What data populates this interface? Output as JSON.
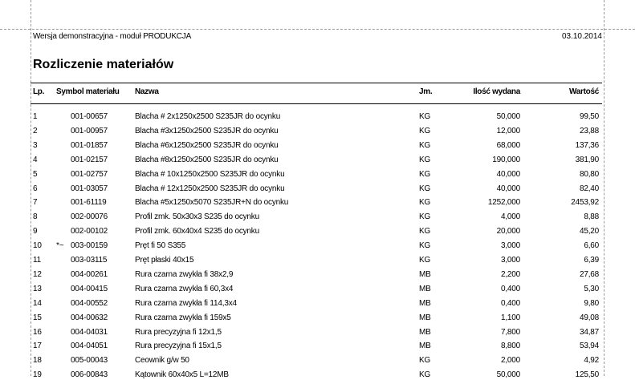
{
  "report": {
    "header_left": "Wersja demonstracyjna - moduł PRODUKCJA",
    "header_date": "03.10.2014",
    "title": "Rozliczenie materiałów"
  },
  "table": {
    "columns": {
      "lp": "Lp.",
      "symbol": "Symbol materiału",
      "name": "Nazwa",
      "unit": "Jm.",
      "qty": "Ilość wydana",
      "value": "Wartość"
    },
    "rows": [
      {
        "lp": "1",
        "marker": "",
        "symbol": "001-00657",
        "name": "Blacha # 2x1250x2500 S235JR do ocynku",
        "unit": "KG",
        "qty": "50,000",
        "value": "99,50"
      },
      {
        "lp": "2",
        "marker": "",
        "symbol": "001-00957",
        "name": "Blacha #3x1250x2500 S235JR do ocynku",
        "unit": "KG",
        "qty": "12,000",
        "value": "23,88"
      },
      {
        "lp": "3",
        "marker": "",
        "symbol": "001-01857",
        "name": "Blacha #6x1250x2500 S235JR do ocynku",
        "unit": "KG",
        "qty": "68,000",
        "value": "137,36"
      },
      {
        "lp": "4",
        "marker": "",
        "symbol": "001-02157",
        "name": "Blacha #8x1250x2500 S235JR do ocynku",
        "unit": "KG",
        "qty": "190,000",
        "value": "381,90"
      },
      {
        "lp": "5",
        "marker": "",
        "symbol": "001-02757",
        "name": "Blacha # 10x1250x2500 S235JR do ocynku",
        "unit": "KG",
        "qty": "40,000",
        "value": "80,80"
      },
      {
        "lp": "6",
        "marker": "",
        "symbol": "001-03057",
        "name": "Blacha # 12x1250x2500 S235JR do ocynku",
        "unit": "KG",
        "qty": "40,000",
        "value": "82,40"
      },
      {
        "lp": "7",
        "marker": "",
        "symbol": "001-61119",
        "name": "Blacha #5x1250x5070 S235JR+N do ocynku",
        "unit": "KG",
        "qty": "1252,000",
        "value": "2453,92"
      },
      {
        "lp": "8",
        "marker": "",
        "symbol": "002-00076",
        "name": "Profil zmk. 50x30x3 S235 do ocynku",
        "unit": "KG",
        "qty": "4,000",
        "value": "8,88"
      },
      {
        "lp": "9",
        "marker": "",
        "symbol": "002-00102",
        "name": "Profil zmk. 60x40x4 S235 do ocynku",
        "unit": "KG",
        "qty": "20,000",
        "value": "45,20"
      },
      {
        "lp": "10",
        "marker": "*~",
        "symbol": "003-00159",
        "name": "Pręt fi 50  S355",
        "unit": "KG",
        "qty": "3,000",
        "value": "6,60"
      },
      {
        "lp": "11",
        "marker": "",
        "symbol": "003-03115",
        "name": "Pręt płaski 40x15",
        "unit": "KG",
        "qty": "3,000",
        "value": "6,39"
      },
      {
        "lp": "12",
        "marker": "",
        "symbol": "004-00261",
        "name": "Rura czarna zwykła fi 38x2,9",
        "unit": "MB",
        "qty": "2,200",
        "value": "27,68"
      },
      {
        "lp": "13",
        "marker": "",
        "symbol": "004-00415",
        "name": "Rura czarna zwykła fi 60,3x4",
        "unit": "MB",
        "qty": "0,400",
        "value": "5,30"
      },
      {
        "lp": "14",
        "marker": "",
        "symbol": "004-00552",
        "name": "Rura czarna zwykła fi 114,3x4",
        "unit": "MB",
        "qty": "0,400",
        "value": "9,80"
      },
      {
        "lp": "15",
        "marker": "",
        "symbol": "004-00632",
        "name": "Rura czarna zwykła fi 159x5",
        "unit": "MB",
        "qty": "1,100",
        "value": "49,08"
      },
      {
        "lp": "16",
        "marker": "",
        "symbol": "004-04031",
        "name": "Rura precyzyjna fi 12x1,5",
        "unit": "MB",
        "qty": "7,800",
        "value": "34,87"
      },
      {
        "lp": "17",
        "marker": "",
        "symbol": "004-04051",
        "name": "Rura precyzyjna fi 15x1,5",
        "unit": "MB",
        "qty": "8,800",
        "value": "53,94"
      },
      {
        "lp": "18",
        "marker": "",
        "symbol": "005-00043",
        "name": "Ceownik g/w 50",
        "unit": "KG",
        "qty": "2,000",
        "value": "4,92"
      },
      {
        "lp": "19",
        "marker": "",
        "symbol": "006-00843",
        "name": "Kątownik 60x40x5 L=12MB",
        "unit": "KG",
        "qty": "50,000",
        "value": "125,50"
      }
    ]
  }
}
